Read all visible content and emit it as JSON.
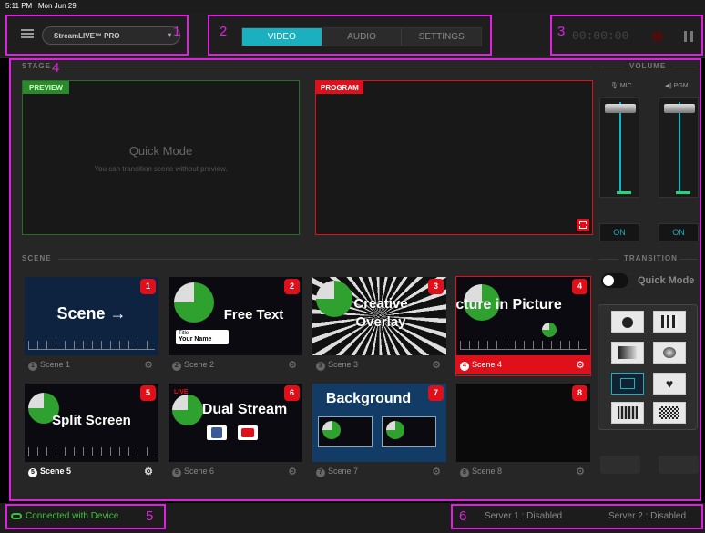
{
  "status": {
    "time": "5:11 PM",
    "date": "Mon Jun 29"
  },
  "header": {
    "app_selector": "StreamLIVE™ PRO",
    "tabs": [
      {
        "label": "VIDEO",
        "active": true
      },
      {
        "label": "AUDIO",
        "active": false
      },
      {
        "label": "SETTINGS",
        "active": false
      }
    ],
    "timer": "00:00:00"
  },
  "stage": {
    "section_label": "STAGE",
    "preview": {
      "tag": "PREVIEW",
      "title": "Quick Mode",
      "subtitle": "You can transition scene without preview."
    },
    "program": {
      "tag": "PROGRAM"
    }
  },
  "volume": {
    "section_label": "VOLUME",
    "mic": {
      "label": "MIC",
      "on_label": "ON"
    },
    "pgm": {
      "label": "PGM",
      "on_label": "ON"
    }
  },
  "scene": {
    "section_label": "SCENE",
    "items": [
      {
        "num": "1",
        "badge": "1",
        "label": "Scene 1",
        "text": "Scene →"
      },
      {
        "num": "2",
        "badge": "2",
        "label": "Scene 2",
        "text": "Free Text",
        "lower_title": "Title",
        "lower_name": "Your Name"
      },
      {
        "num": "3",
        "badge": "3",
        "label": "Scene 3",
        "text": "Creative Overlay"
      },
      {
        "num": "4",
        "badge": "4",
        "label": "Scene 4",
        "text": "Picture in Picture"
      },
      {
        "num": "5",
        "badge": "5",
        "label": "Scene 5",
        "text": "Split Screen"
      },
      {
        "num": "6",
        "badge": "6",
        "label": "Scene 6",
        "text": "Dual Stream",
        "live": "LIVE"
      },
      {
        "num": "7",
        "badge": "7",
        "label": "Scene 7",
        "text": "Background"
      },
      {
        "num": "8",
        "badge": "8",
        "label": "Scene 8",
        "text": ""
      }
    ]
  },
  "transition": {
    "section_label": "TRANSITION",
    "quick_mode_label": "Quick Mode"
  },
  "footer": {
    "connection": "Connected with Device",
    "server1": "Server 1 :  Disabled",
    "server2": "Server 2 :  Disabled"
  },
  "annotations": [
    "1",
    "2",
    "3",
    "4",
    "5",
    "6"
  ],
  "colors": {
    "accent": "#1ab0c0",
    "program": "#e0101a",
    "preview": "#2a8a2a",
    "highlight": "#e020e0",
    "connected": "#3fbf3f"
  }
}
